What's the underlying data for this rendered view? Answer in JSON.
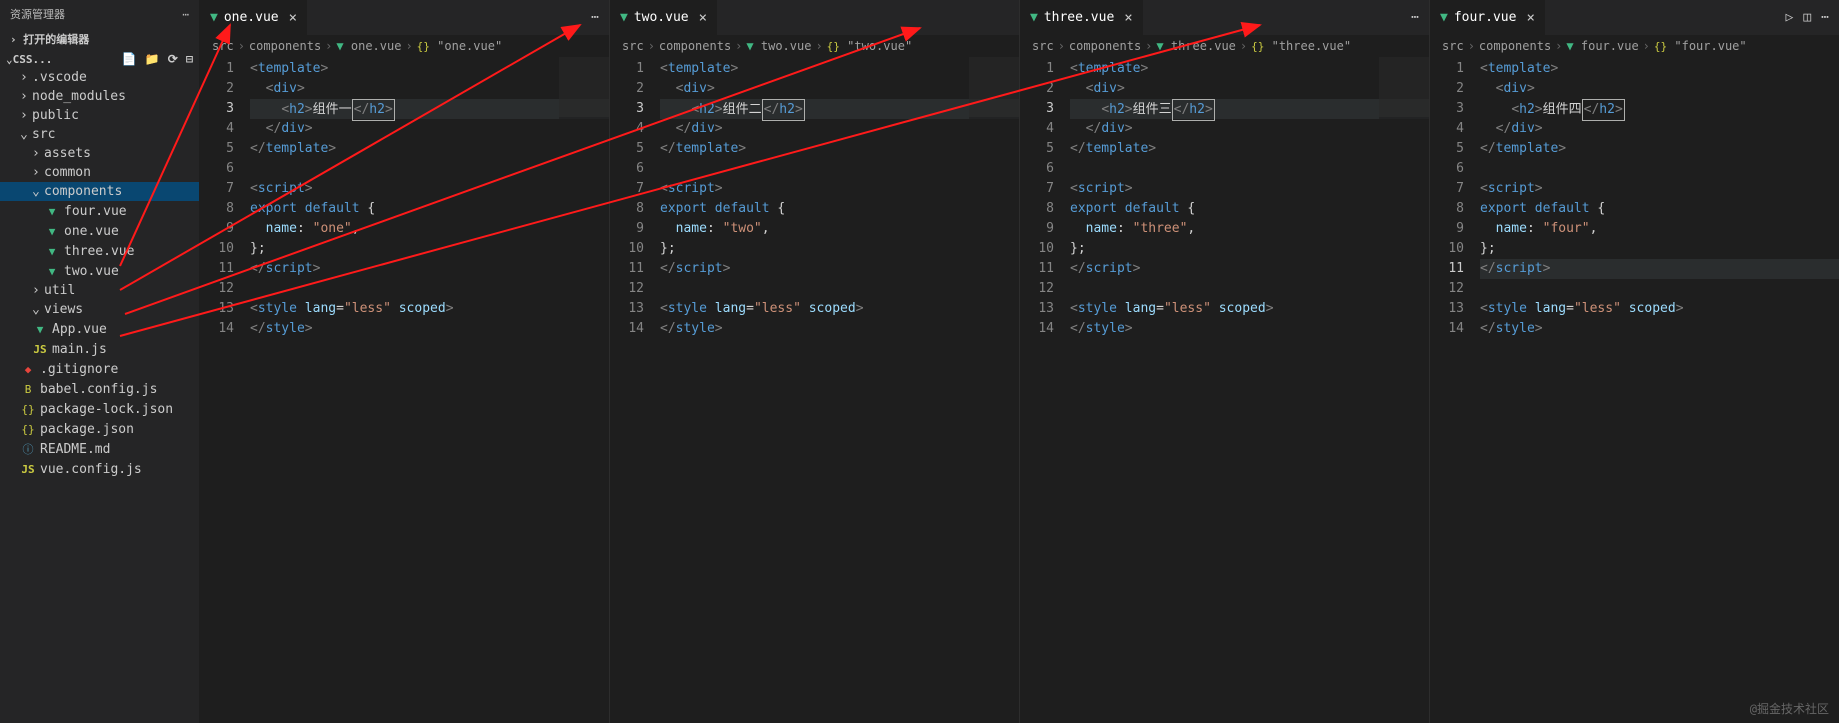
{
  "sidebar": {
    "title": "资源管理器",
    "section": "打开的编辑器",
    "project": "CSS...",
    "tree": [
      {
        "chev": "›",
        "label": ".vscode",
        "indent": 1
      },
      {
        "chev": "›",
        "label": "node_modules",
        "indent": 1
      },
      {
        "chev": "›",
        "label": "public",
        "indent": 1
      },
      {
        "chev": "⌄",
        "label": "src",
        "indent": 1
      },
      {
        "chev": "›",
        "label": "assets",
        "indent": 2
      },
      {
        "chev": "›",
        "label": "common",
        "indent": 2
      },
      {
        "chev": "⌄",
        "label": "components",
        "indent": 2,
        "selected": true
      },
      {
        "icon": "vue",
        "label": "four.vue",
        "indent": 3
      },
      {
        "icon": "vue",
        "label": "one.vue",
        "indent": 3
      },
      {
        "icon": "vue",
        "label": "three.vue",
        "indent": 3
      },
      {
        "icon": "vue",
        "label": "two.vue",
        "indent": 3
      },
      {
        "chev": "›",
        "label": "util",
        "indent": 2
      },
      {
        "chev": "⌄",
        "label": "views",
        "indent": 2
      },
      {
        "icon": "vue",
        "label": "App.vue",
        "indent": 2
      },
      {
        "icon": "js",
        "label": "main.js",
        "indent": 2
      },
      {
        "icon": "git",
        "label": ".gitignore",
        "indent": 1
      },
      {
        "icon": "babel",
        "label": "babel.config.js",
        "indent": 1
      },
      {
        "icon": "brace",
        "label": "package-lock.json",
        "indent": 1
      },
      {
        "icon": "brace",
        "label": "package.json",
        "indent": 1
      },
      {
        "icon": "info",
        "label": "README.md",
        "indent": 1
      },
      {
        "icon": "js",
        "label": "vue.config.js",
        "indent": 1
      }
    ]
  },
  "panes": [
    {
      "tab": "one.vue",
      "breadcrumb": [
        "src",
        "components",
        "one.vue",
        "\"one.vue\""
      ],
      "highlight": 3,
      "component_label": "组件一",
      "name_value": "\"one\"",
      "last_actions": true
    },
    {
      "tab": "two.vue",
      "breadcrumb": [
        "src",
        "components",
        "two.vue",
        "\"two.vue\""
      ],
      "highlight": 3,
      "component_label": "组件二",
      "name_value": "\"two\"",
      "last_actions": false
    },
    {
      "tab": "three.vue",
      "breadcrumb": [
        "src",
        "components",
        "three.vue",
        "\"three.vue\""
      ],
      "highlight": 3,
      "component_label": "组件三",
      "name_value": "\"three\"",
      "last_actions": true
    },
    {
      "tab": "four.vue",
      "breadcrumb": [
        "src",
        "components",
        "four.vue",
        "\"four.vue\""
      ],
      "highlight": 11,
      "component_label": "组件四",
      "name_value": "\"four\"",
      "last_actions": true,
      "run_icons": true
    }
  ],
  "watermark": "@掘金技术社区"
}
